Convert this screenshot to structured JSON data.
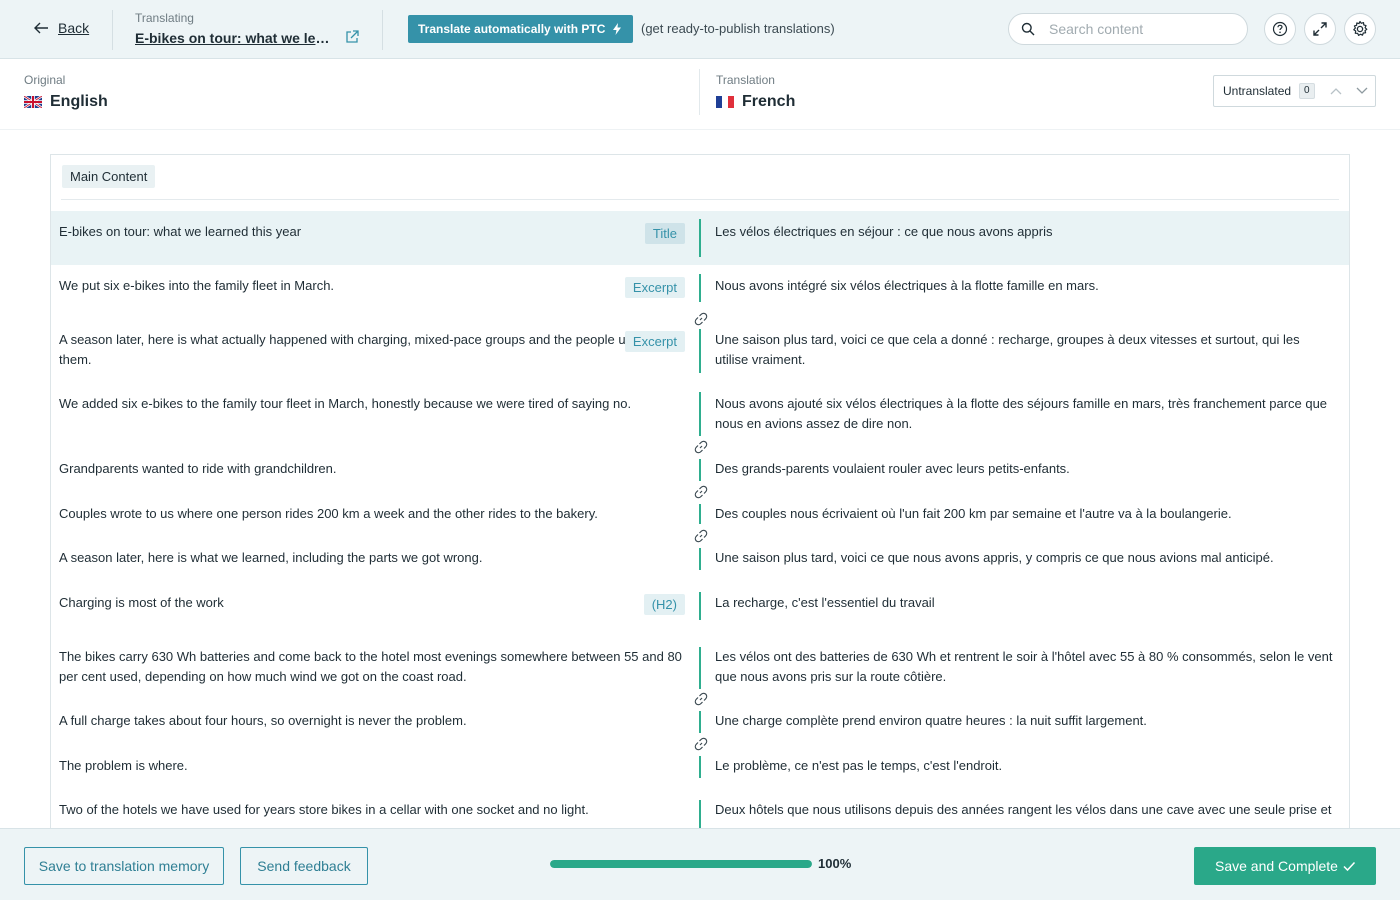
{
  "topbar": {
    "back_label": "Back",
    "translating_caption": "Translating",
    "document_title": "E-bikes on tour: what we learned this year",
    "ptc_button_label": "Translate automatically with PTC",
    "ptc_note": "(get ready-to-publish translations)",
    "search_placeholder": "Search content",
    "icons": [
      "arrow-left-icon",
      "external-link-icon",
      "bolt-icon",
      "search-icon",
      "help-icon",
      "expand-icon",
      "gear-icon"
    ]
  },
  "languages": {
    "original_caption": "Original",
    "original_name": "English",
    "translation_caption": "Translation",
    "translation_name": "French",
    "filter_label": "Untranslated",
    "filter_count": "0"
  },
  "content": {
    "section_label": "Main Content",
    "rows": [
      {
        "source": "E-bikes on tour: what we learned this year",
        "tag": "Title",
        "target": "Les vélos électriques en séjour : ce que nous avons appris"
      },
      {
        "source": "We put six e-bikes into the family fleet in March.",
        "tag": "Excerpt",
        "target": "Nous avons intégré six vélos électriques à la flotte famille en mars."
      },
      {
        "source": "A season later, here is what actually happened with charging, mixed-pace groups and the people using them.",
        "tag": "Excerpt",
        "target": "Une saison plus tard, voici ce que cela a donné : recharge, groupes à deux vitesses et surtout, qui les utilise vraiment."
      },
      {
        "source": "We added six e-bikes to the family tour fleet in March, honestly because we were tired of saying no.",
        "tag": "",
        "target": "Nous avons ajouté six vélos électriques à la flotte des séjours famille en mars, très franchement parce que nous en avions assez de dire non."
      },
      {
        "source": "Grandparents wanted to ride with grandchildren.",
        "tag": "",
        "target": "Des grands-parents voulaient rouler avec leurs petits-enfants."
      },
      {
        "source": "Couples wrote to us where one person rides 200 km a week and the other rides to the bakery.",
        "tag": "",
        "target": "Des couples nous écrivaient où l'un fait 200 km par semaine et l'autre va à la boulangerie."
      },
      {
        "source": "A season later, here is what we learned, including the parts we got wrong.",
        "tag": "",
        "target": "Une saison plus tard, voici ce que nous avons appris, y compris ce que nous avions mal anticipé."
      },
      {
        "source": "Charging is most of the work",
        "tag": "(H2)",
        "target": "La recharge, c'est l'essentiel du travail"
      },
      {
        "source": "The bikes carry 630 Wh batteries and come back to the hotel most evenings somewhere between 55 and 80 per cent used, depending on how much wind we got on the coast road.",
        "tag": "",
        "target": "Les vélos ont des batteries de 630 Wh et rentrent le soir à l'hôtel avec 55 à 80 % consommés, selon le vent que nous avons pris sur la route côtière."
      },
      {
        "source": "A full charge takes about four hours, so overnight is never the problem.",
        "tag": "",
        "target": "Une charge complète prend environ quatre heures : la nuit suffit largement."
      },
      {
        "source": "The problem is where.",
        "tag": "",
        "target": "Le problème, ce n'est pas le temps, c'est l'endroit."
      },
      {
        "source": "Two of the hotels we have used for years store bikes in a cellar with one socket and no light.",
        "tag": "",
        "target": "Deux hôtels que nous utilisons depuis des années rangent les vélos dans une cave avec une seule prise et"
      }
    ]
  },
  "bottombar": {
    "save_memory_label": "Save to translation memory",
    "feedback_label": "Send feedback",
    "progress_percent": 100,
    "progress_label": "100%",
    "save_complete_label": "Save and Complete"
  },
  "colors": {
    "accent": "#3592a9",
    "success": "#2aa889",
    "topbar_bg": "#edf4f6"
  }
}
